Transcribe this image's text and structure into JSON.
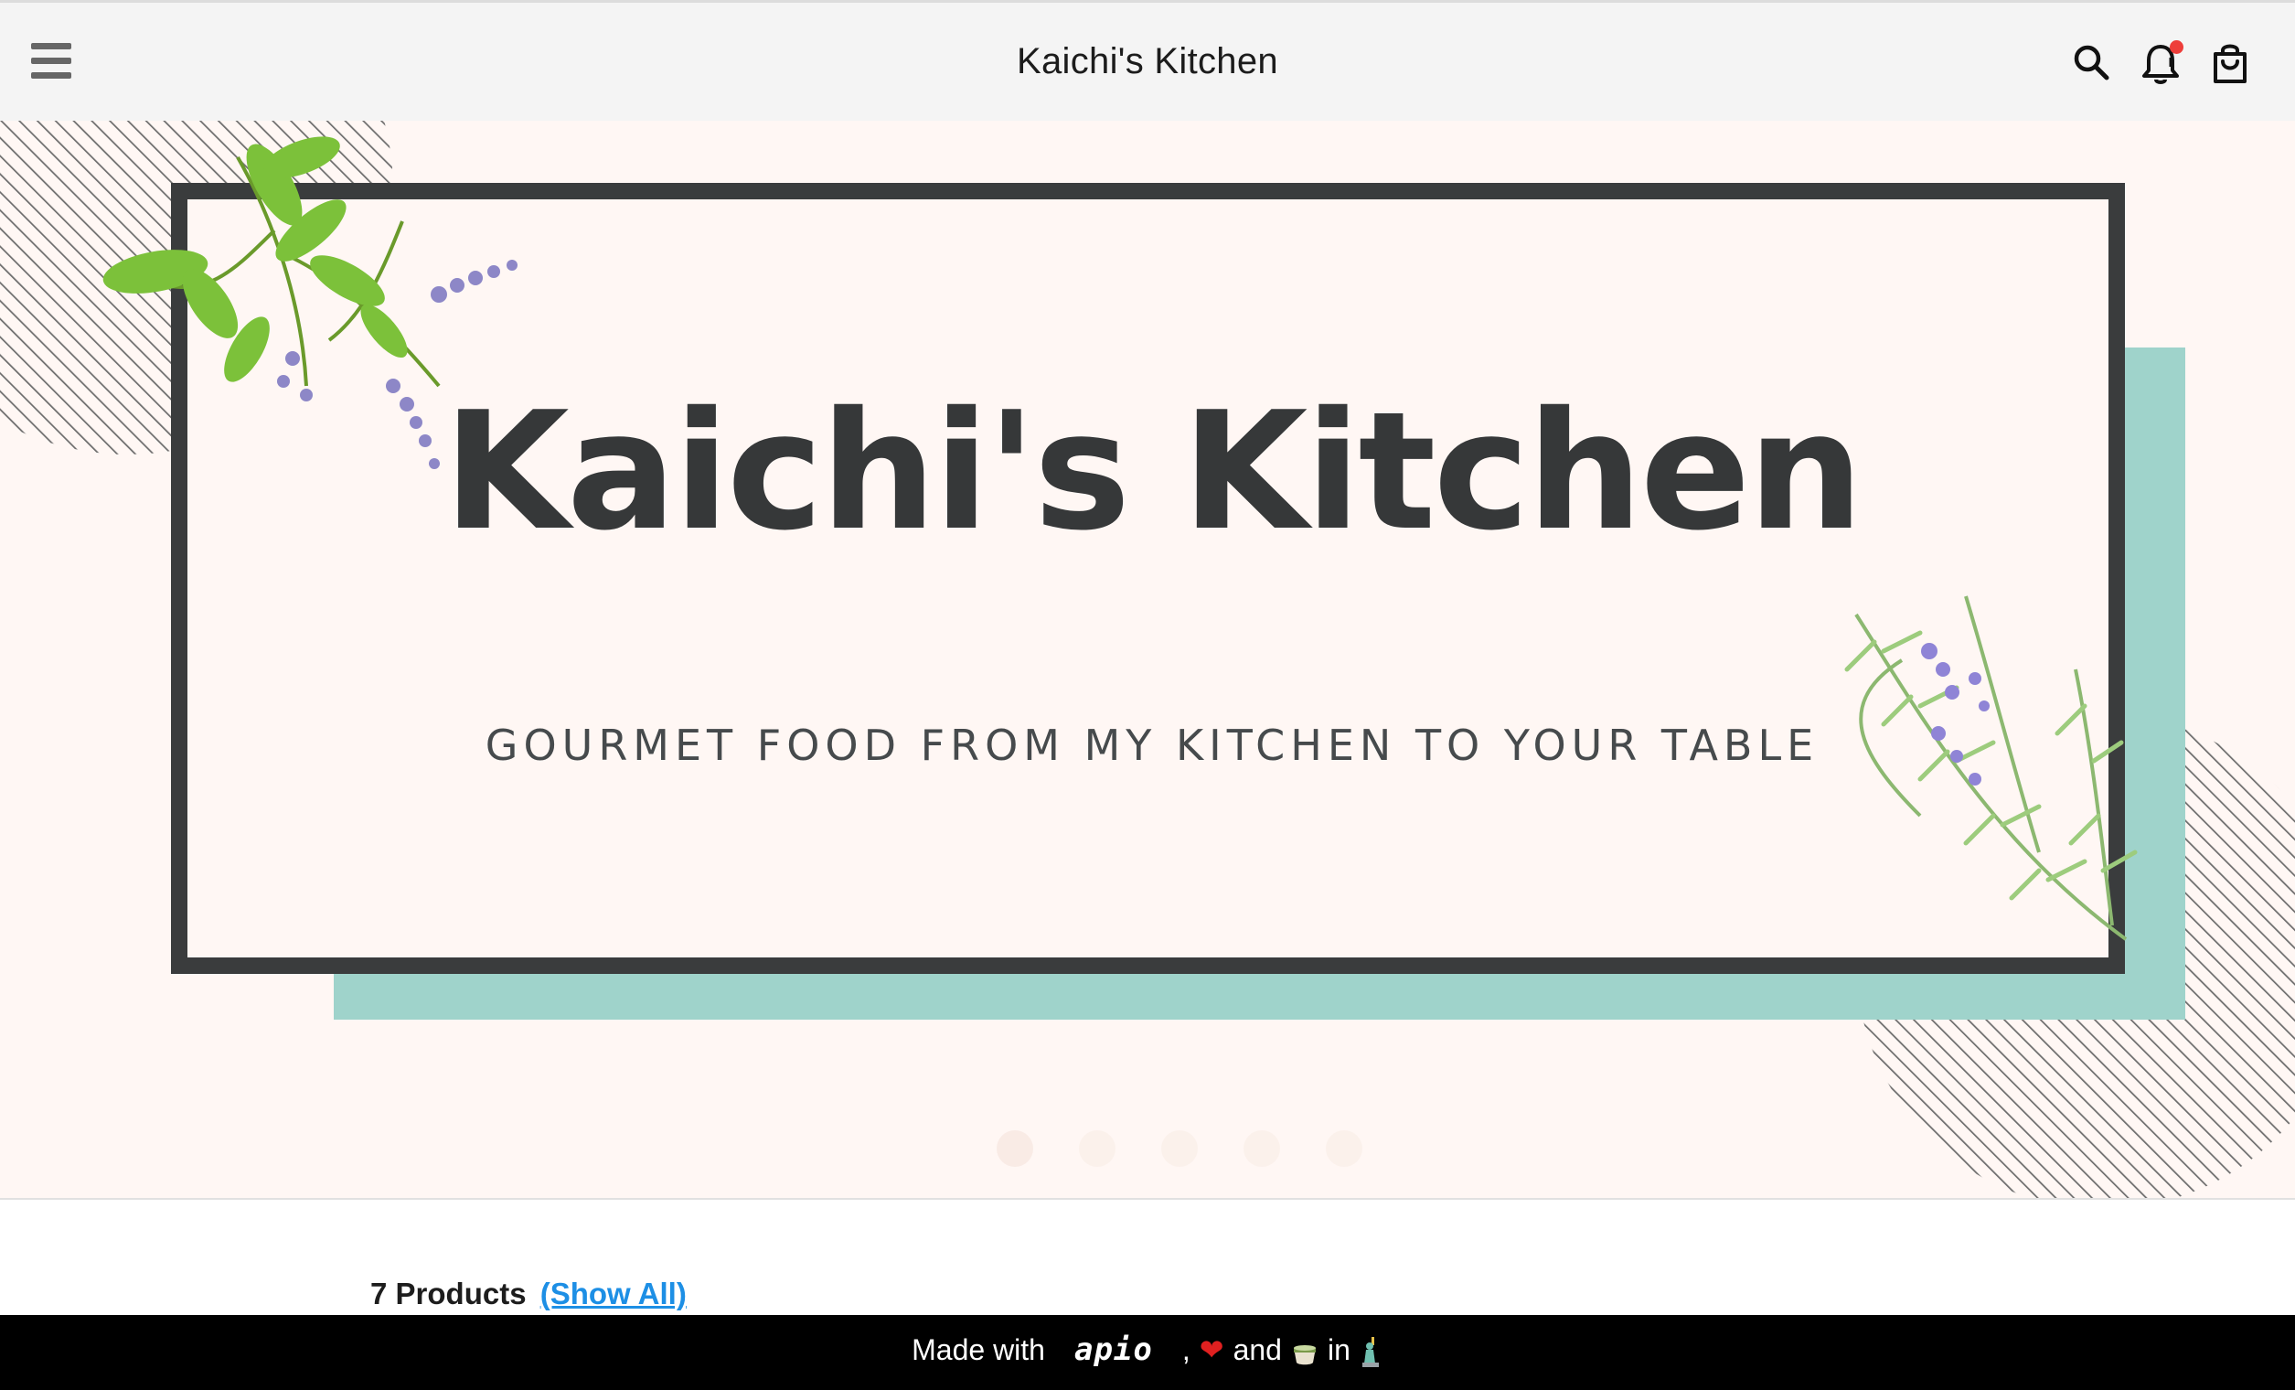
{
  "app_bar": {
    "title": "Kaichi's Kitchen",
    "menu_icon": "hamburger-menu-icon",
    "actions": [
      "search-icon",
      "bell-icon",
      "shopping-bag-icon"
    ],
    "has_notification": true
  },
  "hero": {
    "title": "Kaichi's Kitchen",
    "subtitle": "GOURMET FOOD FROM MY KITCHEN TO YOUR TABLE",
    "slide_count": 5,
    "active_slide": 1,
    "colors": {
      "background": "#fff7f4",
      "frame": "#3a3c3d",
      "accent_block": "#9fd3cb"
    }
  },
  "products": {
    "count_label": "7 Products",
    "show_all_label": "(Show All)"
  },
  "footer": {
    "made_with": "Made with",
    "brand": "apio",
    "and": "and",
    "in": "in",
    "heart_glyph": "❤",
    "icons": [
      "heart-icon",
      "tea-icon",
      "statue-of-liberty-icon"
    ]
  },
  "colors": {
    "link": "#1d8fe5",
    "notification_dot": "#ee3e3a",
    "footer_bg": "#000000"
  }
}
